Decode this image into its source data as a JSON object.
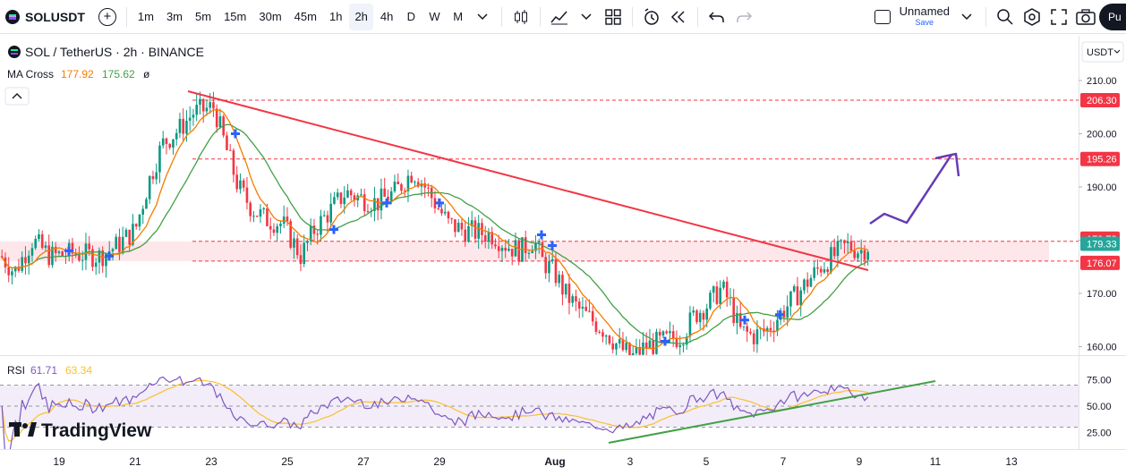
{
  "toolbar": {
    "symbol": "SOLUSDT",
    "intervals": [
      "1m",
      "3m",
      "5m",
      "15m",
      "30m",
      "45m",
      "1h",
      "2h",
      "4h",
      "D",
      "W",
      "M"
    ],
    "active_interval": "2h",
    "layout_name": "Unnamed",
    "layout_save": "Save",
    "publish_label": "Pu"
  },
  "legend": {
    "title": "SOL / TetherUS · 2h · BINANCE",
    "ma_name": "MA Cross",
    "ma_fast": "177.92",
    "ma_slow": "175.62",
    "ma_suffix": "ø",
    "rsi_name": "RSI",
    "rsi_value": "61.71",
    "rsi_ma": "63.34"
  },
  "currency_button": "USDT",
  "watermark": "TradingView",
  "price_axis": {
    "ticks": [
      "210.00",
      "200.00",
      "190.00",
      "180.00",
      "170.00",
      "160.00"
    ]
  },
  "price_labels": {
    "upper": "206.30",
    "mid": "195.26",
    "zone_top": "179.78",
    "current": "179.33",
    "zone_bottom": "176.07"
  },
  "rsi_axis": {
    "ticks": [
      "75.00",
      "50.00",
      "25.00"
    ]
  },
  "time_axis": {
    "labels": [
      "19",
      "21",
      "23",
      "25",
      "27",
      "29",
      "Aug",
      "3",
      "5",
      "7",
      "9",
      "11",
      "13"
    ]
  },
  "colors": {
    "up": "#089981",
    "down": "#f23645",
    "ma_fast": "#f57c00",
    "ma_slow": "#43a047",
    "trend": "#f23645",
    "rsi": "#7e57c2",
    "rsi_ma": "#fbc02d",
    "arrow": "#673ab7",
    "zone": "#ffcdd2",
    "current_label": "#26a69a",
    "cross_marker": "#2962ff"
  }
}
